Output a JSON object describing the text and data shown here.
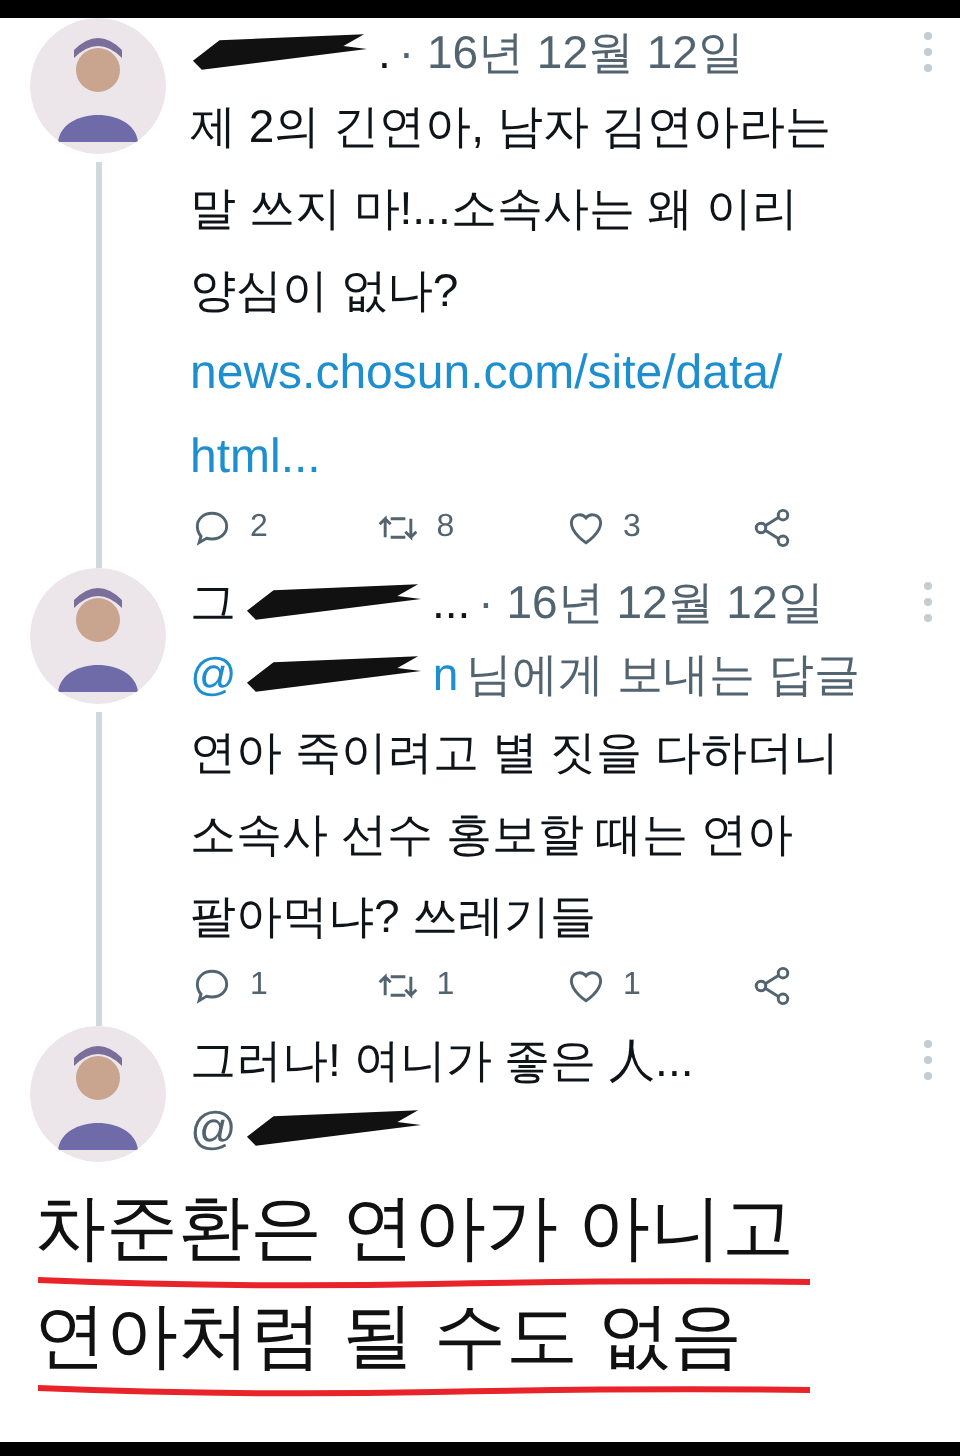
{
  "tweets": [
    {
      "author": [
        {
          "kind": "redacted"
        },
        {
          "kind": "text",
          "text": "."
        }
      ],
      "date": "· 16년 12월 12일",
      "lines": [
        "제 2의 긴연아, 남자 김연아라는",
        "말 쓰지 마!...소속사는 왜 이리",
        "양심이 없나?"
      ],
      "link_lines": [
        "news.chosun.com/site/data/",
        "html..."
      ],
      "actions": [
        {
          "kind": "reply",
          "count": "2"
        },
        {
          "kind": "retweet",
          "count": "8"
        },
        {
          "kind": "like",
          "count": "3"
        },
        {
          "kind": "share"
        }
      ],
      "thread_line": true
    },
    {
      "author": [
        {
          "kind": "text",
          "text": "그"
        },
        {
          "kind": "redacted"
        },
        {
          "kind": "text",
          "text": "..."
        }
      ],
      "date": "· 16년 12월 12일",
      "reply_to": {
        "mention": [
          {
            "kind": "text",
            "text": "@"
          },
          {
            "kind": "redacted"
          },
          {
            "kind": "text",
            "text": "n"
          }
        ],
        "label": "님에게 보내는 답글"
      },
      "lines": [
        "연아 죽이려고 별 짓을 다하더니",
        "소속사 선수 홍보할 때는 연아",
        "팔아먹냐? 쓰레기들"
      ],
      "actions": [
        {
          "kind": "reply",
          "count": "1"
        },
        {
          "kind": "retweet",
          "count": "1"
        },
        {
          "kind": "like",
          "count": "1"
        },
        {
          "kind": "share"
        }
      ],
      "thread_line": true
    },
    {
      "author": [
        {
          "kind": "text",
          "text": "그러나! 여니가 좋은 人..."
        }
      ],
      "handle": [
        {
          "kind": "text",
          "text": "@"
        },
        {
          "kind": "redacted"
        }
      ],
      "thread_line": false
    }
  ],
  "caption_lines": [
    "차준환은 연아가 아니고",
    "연아처럼 될 수도 없음"
  ]
}
